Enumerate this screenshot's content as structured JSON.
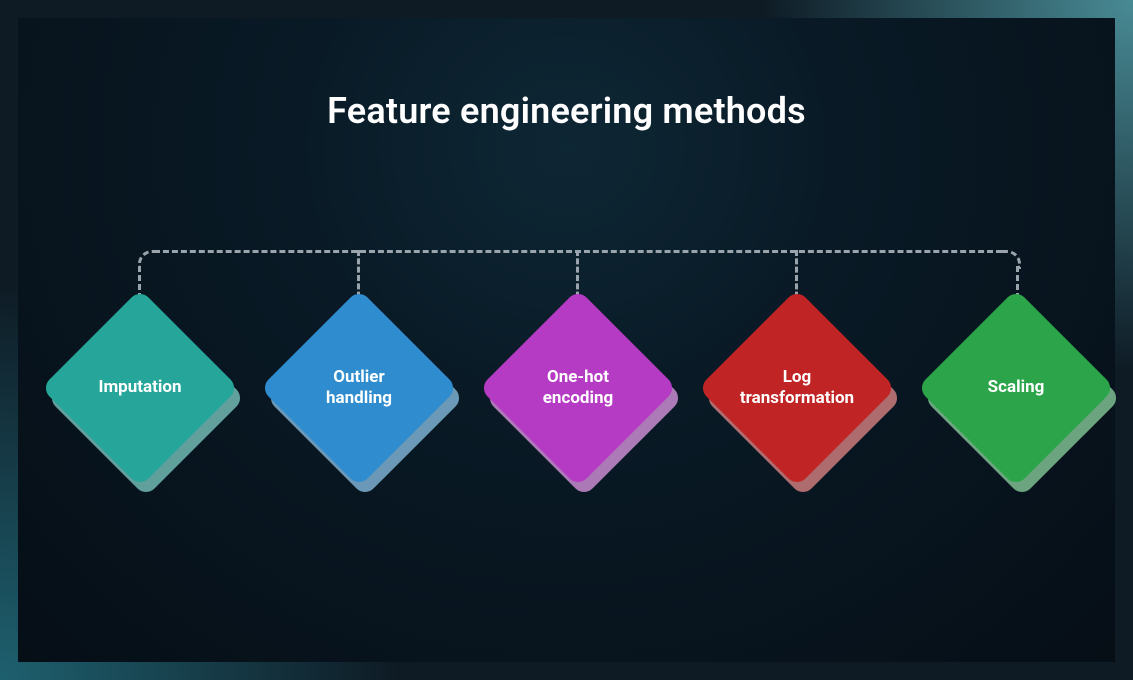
{
  "title": "Feature engineering methods",
  "nodes": {
    "n1": "Imputation",
    "n2": "Outlier handling",
    "n3": "One-hot encoding",
    "n4": "Log transformation",
    "n5": "Scaling"
  }
}
